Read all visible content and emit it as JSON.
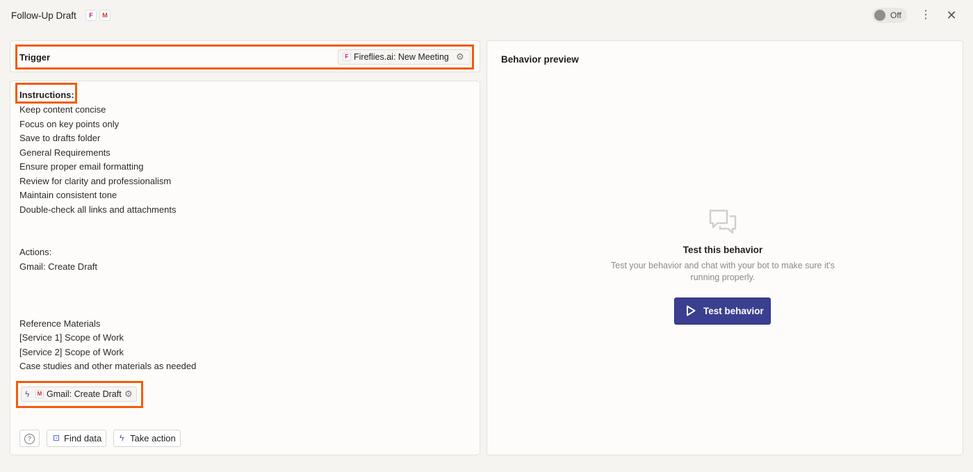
{
  "header": {
    "title": "Follow-Up Draft",
    "app_badges": [
      "fireflies-icon",
      "gmail-icon"
    ],
    "toggle_label": "Off"
  },
  "trigger": {
    "label": "Trigger",
    "chip_label": "Fireflies.ai: New Meeting"
  },
  "instructions": {
    "title": "Instructions:",
    "lines": [
      "Keep content concise",
      "Focus on key points only",
      "Save to drafts folder",
      "General Requirements",
      "Ensure proper email formatting",
      "Review for clarity and professionalism",
      "Maintain consistent tone",
      "Double-check all links and attachments",
      "Actions:",
      "Gmail: Create Draft",
      "Reference Materials",
      "[Service 1] Scope of Work",
      "[Service 2] Scope of Work",
      "Case studies and other materials as needed"
    ],
    "action_chip_label": "Gmail: Create Draft"
  },
  "footer_buttons": {
    "find_data": "Find data",
    "take_action": "Take action"
  },
  "preview": {
    "title": "Behavior preview",
    "empty_title": "Test this behavior",
    "empty_subtitle": "Test your behavior and chat with your bot to make sure it's running properly.",
    "test_button": "Test behavior"
  },
  "colors": {
    "highlight": "#f25c0a",
    "primary_button": "#3b3f8f",
    "fireflies_brand": "#d1007f",
    "gmail_brand": "#d93025"
  }
}
